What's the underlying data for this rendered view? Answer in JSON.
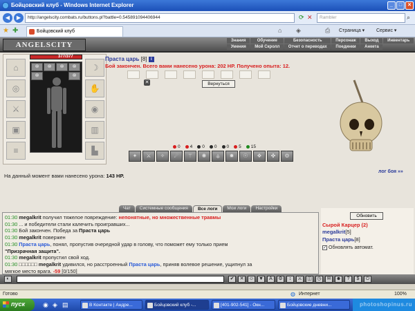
{
  "window": {
    "title": "Бойцовский клуб - Windows Internet Explorer"
  },
  "browser": {
    "url": "http://angelscity.combats.ru/buttons.pl?battle=0.545891094406944",
    "search_placeholder": "Rambler",
    "tab_title": "Бойцовский клуб",
    "tools": {
      "page": "Страница",
      "service": "Сервис"
    }
  },
  "game": {
    "logo": "ANGELSCITY",
    "menu": [
      "Знания",
      "Обучение",
      "Безопасность",
      "Персонаж",
      "Выход",
      "Инвентарь",
      "Умения",
      "Мой Скролл",
      "Отчет о переводах",
      "Поединки",
      "Анкета"
    ],
    "hp_text": "377/377",
    "hp_fraction": 1.0,
    "player": {
      "name": "Праста царь",
      "level": "[8]"
    },
    "battle_result": "Бой закончен. Всего вами нанесено урона: 202 HP. Получено опыта: 12.",
    "return_button": "Вернуться",
    "stats": [
      {
        "value": "0",
        "color": "#d81e1e"
      },
      {
        "value": "4",
        "color": "#d81e1e"
      },
      {
        "value": "0",
        "color": "#2a2a2a"
      },
      {
        "value": "0",
        "color": "#2a2a2a"
      },
      {
        "value": "0",
        "color": "#2a2a2a"
      },
      {
        "value": "5",
        "color": "#d81e1e"
      },
      {
        "value": "15",
        "color": "#1e8a1e"
      }
    ],
    "battle_log_link": "лог боя »»",
    "damage_text": "На данный момент вами нанесено урона:",
    "damage_value": "143 HP."
  },
  "chat": {
    "tabs": [
      "Чат",
      "Системные сообщения",
      "Все логи",
      "Мои логи",
      "Настройки"
    ],
    "active_tab": "Все логи",
    "lines": [
      {
        "time": "01:30",
        "nick": "megalkrit",
        "text": " получил тяжелое повреждение: ",
        "red": "непонятные, но множественные травмы"
      },
      {
        "time": "01:30",
        "text": " ... и победители стали калечить проигравших..."
      },
      {
        "time": "01:30",
        "text": " Бой закончен. Победа за ",
        "bold": "Праста царь"
      },
      {
        "time": "01:30",
        "nick": "megalkrit",
        "text": " повержен"
      },
      {
        "time": "01:30",
        "nick_blue": "Праста царь",
        "text": ", понял, пропустив очередной удар в голову, что поможет ему только прием"
      },
      {
        "text": "\"Призрачная защита\".",
        "boldall": true
      },
      {
        "time": "01:30",
        "nick": "megalkrit",
        "text": " пропустил свой ход."
      },
      {
        "time": "01:30",
        "prefix": "□□□□□□ ",
        "nick": "megalkrit",
        "text": " удивился, но расстроенный ",
        "blue": "Праста царь",
        "text2": ", приняв волевое решение, ущипнул за"
      },
      {
        "text": "мягкое место врага. ",
        "red": "-59",
        "text2": " [0/150]"
      }
    ]
  },
  "online": {
    "refresh_button": "Обновить",
    "room": "Сырой Карцер (2)",
    "users": [
      {
        "name": "megalkrit",
        "level": "[5]"
      },
      {
        "name": "Праста царь",
        "level": "[8]"
      }
    ],
    "auto_refresh": "Обновлять автомат."
  },
  "statusbar": {
    "left": "Готово",
    "zone": "Интернет",
    "zoom": "100%"
  },
  "taskbar": {
    "start": "пуск",
    "buttons": [
      "В Контакте | Андре...",
      "Бойцовский клуб -...",
      "[401-902-541] - Окн...",
      "Бойцовские дневни..."
    ]
  },
  "watermark": "photoshopinus.ru"
}
